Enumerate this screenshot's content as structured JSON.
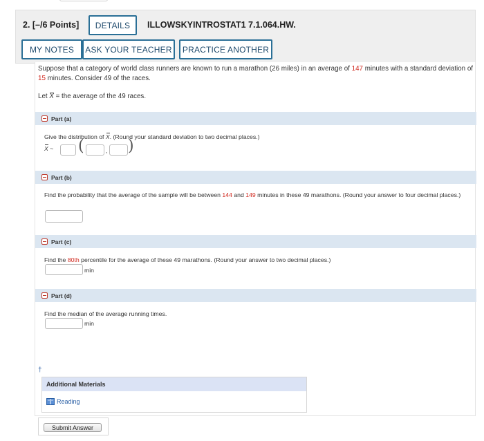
{
  "question": {
    "number_points": "2.  [–/6 Points]",
    "details_label": "DETAILS",
    "code": "ILLOWSKYINTROSTAT1 7.1.064.HW.",
    "my_notes_label": "MY NOTES",
    "ask_teacher_label": "ASK YOUR TEACHER",
    "practice_label": "PRACTICE ANOTHER"
  },
  "intro": {
    "text_1": "Suppose that a category of world class runners are known to run a marathon (26 miles) in an average of ",
    "mean": "147",
    "text_2": " minutes with a standard deviation of ",
    "sd": "15",
    "text_3": " minutes. Consider 49 of the races.",
    "let_prefix": "Let ",
    "let_var": "X",
    "let_suffix": " = the average of the 49 races."
  },
  "parts": {
    "a": {
      "label": "Part (a)",
      "text_prefix": "Give the distribution of ",
      "text_var": "X",
      "text_suffix": ".  (Round your standard deviation to two decimal places.)",
      "dist_var": "X",
      "tilde": "~",
      "comma": ","
    },
    "b": {
      "label": "Part (b)",
      "text_1": "Find the probability that the average of the sample will be between ",
      "low": "144",
      "text_2": " and ",
      "high": "149",
      "text_3": " minutes in these 49 marathons. (Round your answer to four decimal places.)"
    },
    "c": {
      "label": "Part (c)",
      "text_1": "Find the ",
      "pct": "80th",
      "text_2": " percentile for the average of these 49 marathons. (Round your answer to two decimal places.)",
      "unit": "min"
    },
    "d": {
      "label": "Part (d)",
      "text": "Find the median of the average running times.",
      "unit": "min"
    }
  },
  "footer": {
    "dagger": "†",
    "materials_title": "Additional Materials",
    "reading_label": "Reading",
    "submit_label": "Submit Answer"
  },
  "colors": {
    "accent": "#2a6f96",
    "highlight_red": "#d0271d",
    "part_header_bg": "#dbe6f1"
  },
  "icons": {
    "collapse": "minus-square-icon",
    "reading": "book-icon"
  }
}
